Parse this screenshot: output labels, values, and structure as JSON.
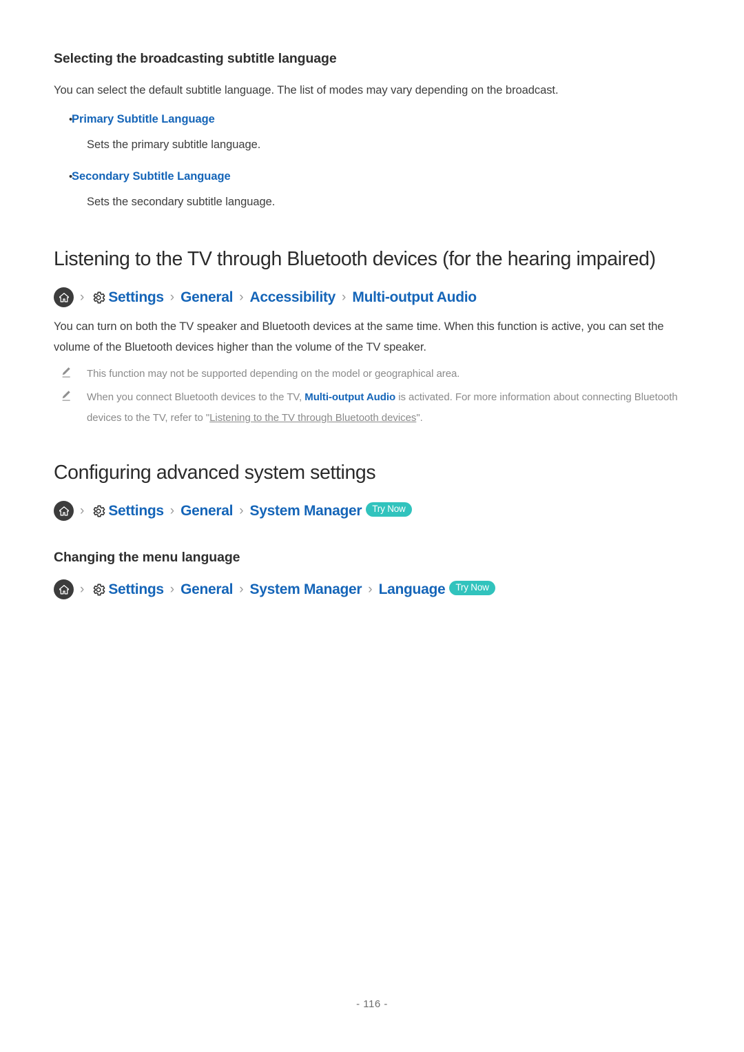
{
  "page": {
    "number_label": "- 116 -",
    "link_color": "#1565b8",
    "badge_color": "#31c3bd",
    "note_color": "#8a8a8a"
  },
  "section_subtitle": {
    "title": "Selecting the broadcasting subtitle language",
    "intro": "You can select the default subtitle language. The list of modes may vary depending on the broadcast.",
    "items": [
      {
        "label": "Primary Subtitle Language",
        "description": "Sets the primary subtitle language."
      },
      {
        "label": "Secondary Subtitle Language",
        "description": "Sets the secondary subtitle language."
      }
    ]
  },
  "section_bluetooth": {
    "title": "Listening to the TV through Bluetooth devices (for the hearing impaired)",
    "breadcrumb": {
      "home_icon": "home-icon",
      "gear_icon": "gear-icon",
      "separator": "›",
      "items": [
        "Settings",
        "General",
        "Accessibility",
        "Multi-output Audio"
      ]
    },
    "body": "You can turn on both the TV speaker and Bluetooth devices at the same time. When this function is active, you can set the volume of the Bluetooth devices higher than the volume of the TV speaker.",
    "notes": [
      {
        "icon": "pencil-note-icon",
        "parts": [
          {
            "type": "plain",
            "text": "This function may not be supported depending on the model or geographical area."
          }
        ]
      },
      {
        "icon": "pencil-note-icon",
        "parts": [
          {
            "type": "plain",
            "text": "When you connect Bluetooth devices to the TV, "
          },
          {
            "type": "emph",
            "text": "Multi-output Audio"
          },
          {
            "type": "plain",
            "text": " is activated. For more information about connecting Bluetooth devices to the TV, refer to \""
          },
          {
            "type": "link",
            "text": "Listening to the TV through Bluetooth devices"
          },
          {
            "type": "plain",
            "text": "\"."
          }
        ]
      }
    ]
  },
  "section_system": {
    "title": "Configuring advanced system settings",
    "breadcrumb": {
      "home_icon": "home-icon",
      "gear_icon": "gear-icon",
      "separator": "›",
      "items": [
        "Settings",
        "General",
        "System Manager"
      ],
      "badge": "Try Now"
    }
  },
  "section_language": {
    "title": "Changing the menu language",
    "breadcrumb": {
      "home_icon": "home-icon",
      "gear_icon": "gear-icon",
      "separator": "›",
      "items": [
        "Settings",
        "General",
        "System Manager",
        "Language"
      ],
      "badge": "Try Now"
    }
  }
}
